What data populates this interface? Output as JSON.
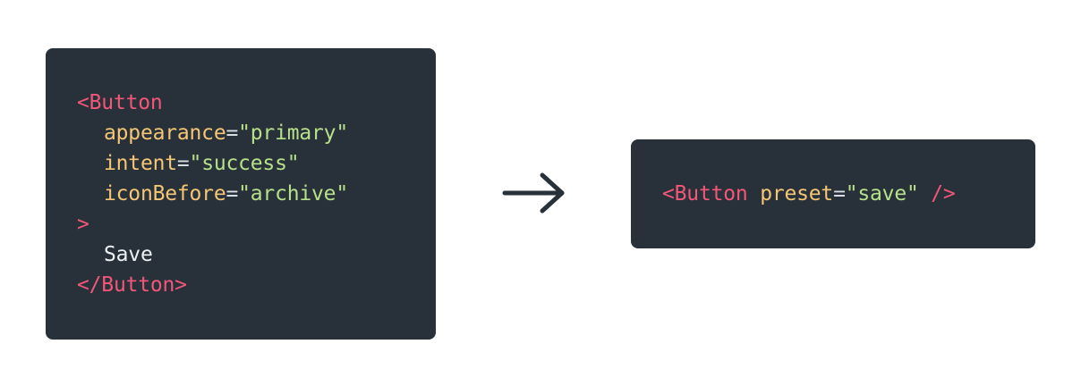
{
  "before": {
    "lines": [
      {
        "tag": "<Button"
      },
      {
        "attr": "appearance",
        "eq": "=",
        "value": "\"primary\""
      },
      {
        "attr": "intent",
        "eq": "=",
        "value": "\"success\""
      },
      {
        "attr": "iconBefore",
        "eq": "=",
        "value": "\"archive\""
      },
      {
        "tag": ">"
      },
      {
        "text": "Save"
      },
      {
        "tag": "</Button>"
      }
    ]
  },
  "after": {
    "open_tag": "<Button",
    "attr": "preset",
    "eq": "=",
    "value": "\"save\"",
    "close_tag": "/>"
  },
  "colors": {
    "panel_bg": "#283139",
    "tag": "#f2577a",
    "attr": "#f5c675",
    "string": "#b7e08a",
    "text": "#eef1f4",
    "arrow": "#283139"
  },
  "icons": {
    "arrow": "arrow-right-icon"
  }
}
